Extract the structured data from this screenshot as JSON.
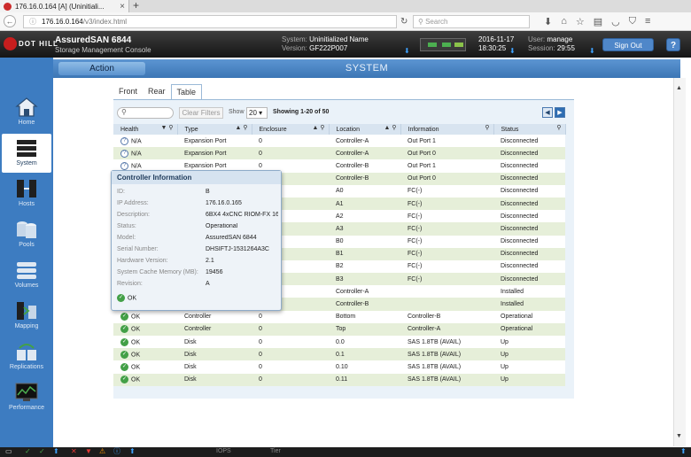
{
  "browser": {
    "tab_title": "176.16.0.164 [A] (Uninitiali...",
    "url_host": "176.16.0.164",
    "url_path": "/v3/index.html",
    "search_placeholder": "Search"
  },
  "header": {
    "brand": "DOT HILL",
    "app_name": "AssuredSAN 6844",
    "app_subtitle": "Storage Management Console",
    "system_label": "System:",
    "system_name": "Uninitialized Name",
    "version_label": "Version:",
    "version": "GF222P007",
    "date": "2016-11-17",
    "time": "18:30:25",
    "user_label": "User:",
    "user": "manage",
    "session_label": "Session:",
    "session": "29:55",
    "sign_out": "Sign Out",
    "help": "?"
  },
  "nav": {
    "action": "Action",
    "title": "SYSTEM"
  },
  "sidebar": {
    "items": [
      {
        "label": "Home"
      },
      {
        "label": "System"
      },
      {
        "label": "Hosts"
      },
      {
        "label": "Pools"
      },
      {
        "label": "Volumes"
      },
      {
        "label": "Mapping"
      },
      {
        "label": "Replications"
      },
      {
        "label": "Performance"
      }
    ]
  },
  "subtabs": {
    "front": "Front",
    "rear": "Rear",
    "table": "Table"
  },
  "filters": {
    "clear": "Clear Filters",
    "show_label": "Show",
    "show_value": "20",
    "showing": "Showing 1-20 of 50"
  },
  "table": {
    "headers": [
      "Health",
      "Type",
      "Enclosure",
      "Location",
      "Information",
      "Status"
    ],
    "rows": [
      {
        "health": "N/A",
        "type": "Expansion Port",
        "enclosure": "0",
        "location": "Controller-A",
        "information": "Out Port 1",
        "status": "Disconnected"
      },
      {
        "health": "N/A",
        "type": "Expansion Port",
        "enclosure": "0",
        "location": "Controller-A",
        "information": "Out Port 0",
        "status": "Disconnected"
      },
      {
        "health": "N/A",
        "type": "Expansion Port",
        "enclosure": "0",
        "location": "Controller-B",
        "information": "Out Port 1",
        "status": "Disconnected"
      },
      {
        "health": "",
        "type": "",
        "enclosure": "",
        "location": "Controller-B",
        "information": "Out Port 0",
        "status": "Disconnected"
      },
      {
        "health": "",
        "type": "",
        "enclosure": "",
        "location": "A0",
        "information": "FC(-)",
        "status": "Disconnected"
      },
      {
        "health": "",
        "type": "",
        "enclosure": "",
        "location": "A1",
        "information": "FC(-)",
        "status": "Disconnected"
      },
      {
        "health": "",
        "type": "",
        "enclosure": "",
        "location": "A2",
        "information": "FC(-)",
        "status": "Disconnected"
      },
      {
        "health": "",
        "type": "",
        "enclosure": "",
        "location": "A3",
        "information": "FC(-)",
        "status": "Disconnected"
      },
      {
        "health": "",
        "type": "",
        "enclosure": "",
        "location": "B0",
        "information": "FC(-)",
        "status": "Disconnected"
      },
      {
        "health": "",
        "type": "",
        "enclosure": "",
        "location": "B1",
        "information": "FC(-)",
        "status": "Disconnected"
      },
      {
        "health": "",
        "type": "",
        "enclosure": "",
        "location": "B2",
        "information": "FC(-)",
        "status": "Disconnected"
      },
      {
        "health": "",
        "type": "",
        "enclosure": "",
        "location": "B3",
        "information": "FC(-)",
        "status": "Disconnected"
      },
      {
        "health": "",
        "type": "",
        "enclosure": "",
        "location": "Controller-A",
        "information": "",
        "status": "Installed"
      },
      {
        "health": "",
        "type": "",
        "enclosure": "",
        "location": "Controller-B",
        "information": "",
        "status": "Installed"
      },
      {
        "health": "OK",
        "type": "Controller",
        "enclosure": "0",
        "location": "Bottom",
        "information": "Controller-B",
        "status": "Operational"
      },
      {
        "health": "OK",
        "type": "Controller",
        "enclosure": "0",
        "location": "Top",
        "information": "Controller-A",
        "status": "Operational"
      },
      {
        "health": "OK",
        "type": "Disk",
        "enclosure": "0",
        "location": "0.0",
        "information": "SAS 1.8TB (AVAIL)",
        "status": "Up"
      },
      {
        "health": "OK",
        "type": "Disk",
        "enclosure": "0",
        "location": "0.1",
        "information": "SAS 1.8TB (AVAIL)",
        "status": "Up"
      },
      {
        "health": "OK",
        "type": "Disk",
        "enclosure": "0",
        "location": "0.10",
        "information": "SAS 1.8TB (AVAIL)",
        "status": "Up"
      },
      {
        "health": "OK",
        "type": "Disk",
        "enclosure": "0",
        "location": "0.11",
        "information": "SAS 1.8TB (AVAIL)",
        "status": "Up"
      }
    ]
  },
  "popup": {
    "title": "Controller Information",
    "rows": [
      {
        "k": "ID:",
        "v": "B"
      },
      {
        "k": "IP Address:",
        "v": "176.16.0.165"
      },
      {
        "k": "Description:",
        "v": "6BX4 4xCNC RIOM-FX 16"
      },
      {
        "k": "Status:",
        "v": "Operational"
      },
      {
        "k": "Model:",
        "v": "AssuredSAN 6844"
      },
      {
        "k": "Serial Number:",
        "v": "DHSIFTJ-1531264A3C"
      },
      {
        "k": "Hardware Version:",
        "v": "2.1"
      },
      {
        "k": "System Cache Memory (MB):",
        "v": "19456"
      },
      {
        "k": "Revision:",
        "v": "A"
      }
    ],
    "health": "OK"
  },
  "statusbar": {
    "iops": "IOPS",
    "tier": "Tier"
  },
  "colors": {
    "accent": "#3d7cc1",
    "ok": "#43a047",
    "row_alt": "#e6efd9"
  }
}
